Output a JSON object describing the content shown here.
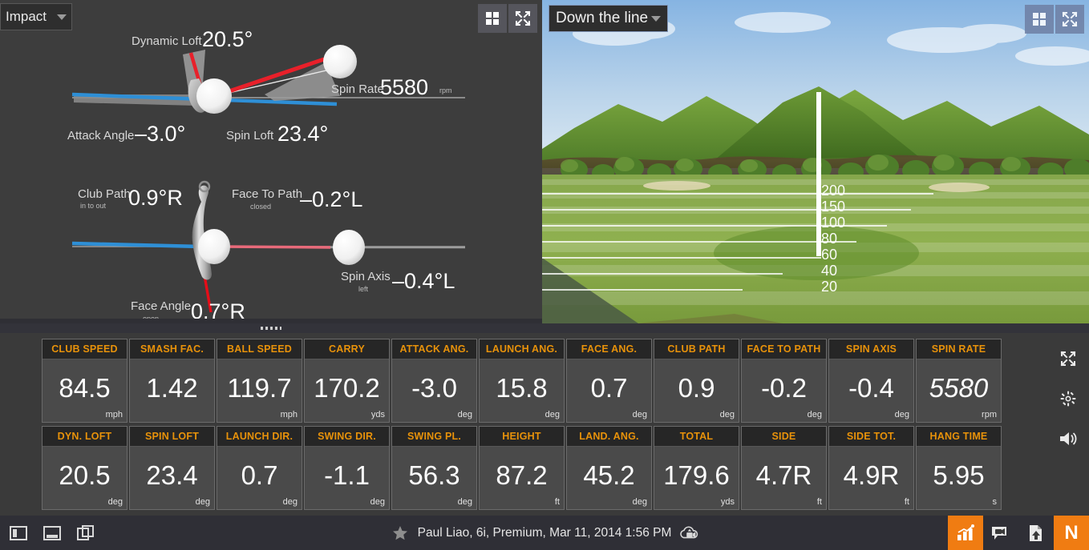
{
  "impact_panel": {
    "view_select": {
      "label": "Impact",
      "icon": "chevron-down-icon"
    },
    "buttons": [
      {
        "name": "grid-layout-button",
        "icon": "grid-icon"
      },
      {
        "name": "fullscreen-button",
        "icon": "expand-arrows-icon"
      }
    ],
    "top_diagram": {
      "metrics": [
        {
          "label": "Dynamic Loft",
          "sub": "",
          "value": "20.5°"
        },
        {
          "label": "Spin Rate",
          "sub": "",
          "value": "5580",
          "unit": "rpm"
        },
        {
          "label": "Attack Angle",
          "sub": "",
          "value": "–3.0°"
        },
        {
          "label": "Spin Loft",
          "sub": "",
          "value": "23.4°"
        }
      ]
    },
    "bottom_diagram": {
      "metrics": [
        {
          "label": "Club Path",
          "sub": "in to out",
          "value": "0.9°R"
        },
        {
          "label": "Face To Path",
          "sub": "closed",
          "value": "–0.2°L"
        },
        {
          "label": "Spin Axis",
          "sub": "left",
          "value": "–0.4°L"
        },
        {
          "label": "Face Angle",
          "sub": "open",
          "value": "0.7°R"
        }
      ]
    }
  },
  "view3d": {
    "camera_select": {
      "label": "Down the line",
      "icon": "chevron-down-icon"
    },
    "buttons": [
      {
        "name": "grid-layout-button",
        "icon": "grid-icon"
      },
      {
        "name": "fullscreen-button",
        "icon": "expand-arrows-icon"
      }
    ],
    "distance_markers": [
      "200",
      "150",
      "100",
      "80",
      "60",
      "40",
      "20"
    ]
  },
  "tiles": {
    "row1": [
      {
        "header": "CLUB SPEED",
        "value": "84.5",
        "unit": "mph",
        "italic": false
      },
      {
        "header": "SMASH FAC.",
        "value": "1.42",
        "unit": "",
        "italic": false
      },
      {
        "header": "BALL SPEED",
        "value": "119.7",
        "unit": "mph",
        "italic": false
      },
      {
        "header": "CARRY",
        "value": "170.2",
        "unit": "yds",
        "italic": false
      },
      {
        "header": "ATTACK ANG.",
        "value": "-3.0",
        "unit": "deg",
        "italic": false
      },
      {
        "header": "LAUNCH ANG.",
        "value": "15.8",
        "unit": "deg",
        "italic": false
      },
      {
        "header": "FACE ANG.",
        "value": "0.7",
        "unit": "deg",
        "italic": false
      },
      {
        "header": "CLUB PATH",
        "value": "0.9",
        "unit": "deg",
        "italic": false
      },
      {
        "header": "FACE TO PATH",
        "value": "-0.2",
        "unit": "deg",
        "italic": false
      },
      {
        "header": "SPIN AXIS",
        "value": "-0.4",
        "unit": "deg",
        "italic": false
      },
      {
        "header": "SPIN RATE",
        "value": "5580",
        "unit": "rpm",
        "italic": true
      }
    ],
    "row2": [
      {
        "header": "DYN. LOFT",
        "value": "20.5",
        "unit": "deg",
        "italic": false
      },
      {
        "header": "SPIN LOFT",
        "value": "23.4",
        "unit": "deg",
        "italic": false
      },
      {
        "header": "LAUNCH DIR.",
        "value": "0.7",
        "unit": "deg",
        "italic": false
      },
      {
        "header": "SWING DIR.",
        "value": "-1.1",
        "unit": "deg",
        "italic": false
      },
      {
        "header": "SWING PL.",
        "value": "56.3",
        "unit": "deg",
        "italic": false
      },
      {
        "header": "HEIGHT",
        "value": "87.2",
        "unit": "ft",
        "italic": false
      },
      {
        "header": "LAND. ANG.",
        "value": "45.2",
        "unit": "deg",
        "italic": false
      },
      {
        "header": "TOTAL",
        "value": "179.6",
        "unit": "yds",
        "italic": false
      },
      {
        "header": "SIDE",
        "value": "4.7R",
        "unit": "ft",
        "italic": false
      },
      {
        "header": "SIDE TOT.",
        "value": "4.9R",
        "unit": "ft",
        "italic": false
      },
      {
        "header": "HANG TIME",
        "value": "5.95",
        "unit": "s",
        "italic": false
      }
    ]
  },
  "right_strip": [
    {
      "name": "expand-icon",
      "icon": "expand-arrows-icon"
    },
    {
      "name": "settings-icon",
      "icon": "gear-icon"
    },
    {
      "name": "volume-icon",
      "icon": "speaker-icon"
    }
  ],
  "statusbar": {
    "left_icons": [
      {
        "name": "panel-left-icon",
        "icon": "layout-left-icon"
      },
      {
        "name": "panel-bottom-icon",
        "icon": "layout-bottom-icon"
      },
      {
        "name": "copy-windows-icon",
        "icon": "windows-stack-icon"
      }
    ],
    "shot_info": "Paul Liao, 6i, Premium, Mar 11, 2014 1:56 PM",
    "favorite_icon": "star-icon",
    "upload_icon": "cloud-upload-video-icon",
    "right_icons": [
      {
        "name": "charts-button",
        "icon": "bar-chart-icon",
        "orange": true,
        "label": ""
      },
      {
        "name": "video-button",
        "icon": "video-comment-icon",
        "orange": false,
        "label": ""
      },
      {
        "name": "report-button",
        "icon": "document-upload-icon",
        "orange": false,
        "label": ""
      },
      {
        "name": "normalize-button",
        "icon": "letter-n-icon",
        "orange": true,
        "label": "N"
      }
    ]
  },
  "colors": {
    "accent_orange": "#e8920a",
    "brand_orange": "#f07c12",
    "panel_bg": "#3d3d3d",
    "tile_bg": "#4a4a4a",
    "tile_header_bg": "#262626",
    "statusbar_bg": "#2f2f36",
    "path_blue": "#2e8fd6",
    "face_red": "#e8202a",
    "ballflight_pink": "#e86a7a"
  }
}
